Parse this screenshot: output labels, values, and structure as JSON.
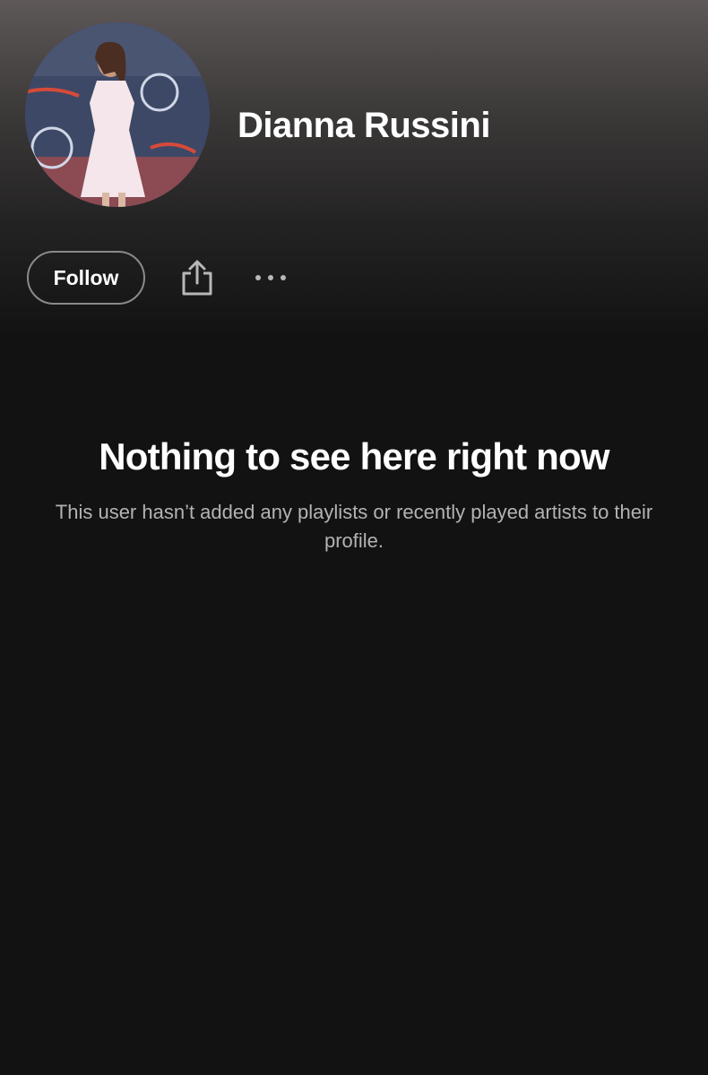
{
  "profile": {
    "name": "Dianna Russini",
    "avatar_icon": "profile-photo"
  },
  "actions": {
    "follow_label": "Follow",
    "share_icon": "share-icon",
    "more_icon": "more-icon"
  },
  "empty_state": {
    "title": "Nothing to see here right now",
    "description": "This user hasn’t added any playlists or recently played artists to their profile."
  },
  "colors": {
    "background": "#121212",
    "header_top": "#5e5858",
    "text_primary": "#ffffff",
    "text_secondary": "#b3b3b3",
    "button_border": "#8a8a8a"
  }
}
